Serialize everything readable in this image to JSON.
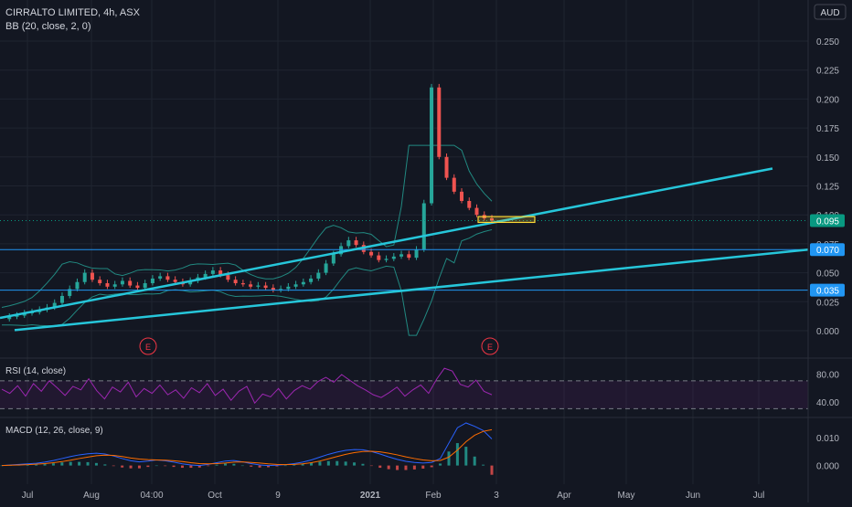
{
  "header": {
    "symbol_line": "CIRRALTO LIMITED, 4h, ASX",
    "indicator_line": "BB (20, close, 2, 0)",
    "currency": "AUD"
  },
  "colors": {
    "background": "#131722",
    "grid": "#1f2430",
    "axis_text": "#b2b5be",
    "trendline": "#26c6da",
    "horizontal_line": "#2196f3",
    "up_candle": "#26a69a",
    "down_candle": "#ef5350",
    "bollinger": "#26a69a",
    "rsi_line": "#9c27b0",
    "macd_line": "#2962ff",
    "signal_line": "#ff6d00",
    "price_badge": "#089981",
    "earnings_marker": "#f23645",
    "highlight_box": "#fdd835"
  },
  "chart_data": [
    {
      "type": "line",
      "name": "price",
      "x_tick_labels": [
        "Jul",
        "Aug",
        "04:00",
        "Oct",
        "9",
        "2021",
        "Feb",
        "3",
        "Apr",
        "May",
        "Jun",
        "Jul"
      ],
      "y_ticks": [
        0.0,
        0.025,
        0.05,
        0.075,
        0.1,
        0.125,
        0.15,
        0.175,
        0.2,
        0.225,
        0.25
      ],
      "y_tick_labels": [
        "0.000",
        "0.025",
        "0.050",
        "0.075",
        "0.100",
        "0.125",
        "0.150",
        "0.175",
        "0.200",
        "0.225",
        "0.250"
      ],
      "ylim": [
        -0.005,
        0.265
      ],
      "grid": true,
      "close_path": [
        0.01,
        0.012,
        0.013,
        0.015,
        0.016,
        0.018,
        0.02,
        0.024,
        0.03,
        0.036,
        0.042,
        0.05,
        0.044,
        0.041,
        0.038,
        0.04,
        0.043,
        0.039,
        0.037,
        0.041,
        0.045,
        0.047,
        0.044,
        0.042,
        0.04,
        0.043,
        0.046,
        0.049,
        0.052,
        0.048,
        0.044,
        0.041,
        0.04,
        0.038,
        0.039,
        0.037,
        0.035,
        0.036,
        0.038,
        0.04,
        0.042,
        0.045,
        0.05,
        0.058,
        0.066,
        0.073,
        0.078,
        0.074,
        0.068,
        0.065,
        0.061,
        0.062,
        0.064,
        0.066,
        0.063,
        0.07,
        0.11,
        0.21,
        0.15,
        0.132,
        0.12,
        0.112,
        0.106,
        0.1,
        0.097,
        0.095
      ],
      "price_labels": [
        {
          "value": 0.095,
          "label": "0.095"
        },
        {
          "value": 0.07,
          "label": "0.070"
        },
        {
          "value": 0.035,
          "label": "0.035"
        }
      ],
      "horizontal_lines": [
        0.07,
        0.035
      ],
      "earnings_markers": [
        "E",
        "E"
      ]
    },
    {
      "type": "line",
      "name": "RSI (14, close)",
      "y_tick_labels": [
        "80.00",
        "40.00"
      ],
      "ylim": [
        20,
        100
      ],
      "bands": [
        70,
        30
      ],
      "values": [
        58,
        52,
        63,
        48,
        66,
        55,
        70,
        60,
        49,
        62,
        57,
        73,
        56,
        44,
        61,
        54,
        68,
        47,
        59,
        52,
        64,
        50,
        57,
        45,
        60,
        53,
        66,
        49,
        58,
        42,
        55,
        62,
        38,
        51,
        47,
        59,
        44,
        56,
        63,
        58,
        69,
        75,
        68,
        79,
        71,
        63,
        57,
        50,
        46,
        53,
        61,
        48,
        57,
        64,
        52,
        72,
        88,
        84,
        65,
        61,
        71,
        55,
        50
      ]
    },
    {
      "type": "line",
      "name": "MACD (12, 26, close, 9)",
      "y_tick_labels": [
        "0.010",
        "0.000"
      ],
      "ylim": [
        -0.006,
        0.0165
      ],
      "macd": [
        0.0,
        0.0002,
        0.0004,
        0.0006,
        0.0008,
        0.0012,
        0.0018,
        0.0025,
        0.0032,
        0.0038,
        0.0042,
        0.0044,
        0.0041,
        0.0034,
        0.0025,
        0.0017,
        0.0013,
        0.0016,
        0.002,
        0.0017,
        0.0012,
        0.0006,
        0.0002,
        0.0,
        0.0004,
        0.001,
        0.0016,
        0.0018,
        0.0013,
        0.0007,
        0.0002,
        0.0,
        0.0001,
        0.0003,
        0.0007,
        0.0012,
        0.002,
        0.003,
        0.004,
        0.0048,
        0.0054,
        0.0057,
        0.0056,
        0.005,
        0.0041,
        0.0031,
        0.0022,
        0.0015,
        0.0011,
        0.0009,
        0.0011,
        0.0025,
        0.008,
        0.0135,
        0.0152,
        0.014,
        0.0125,
        0.0095
      ],
      "signal": [
        0.0,
        0.0001,
        0.0002,
        0.0003,
        0.0005,
        0.0007,
        0.001,
        0.0014,
        0.0019,
        0.0025,
        0.003,
        0.0035,
        0.0037,
        0.0036,
        0.0032,
        0.0027,
        0.0023,
        0.0021,
        0.002,
        0.0019,
        0.0017,
        0.0014,
        0.001,
        0.0007,
        0.0006,
        0.0007,
        0.0009,
        0.0012,
        0.0013,
        0.0011,
        0.0009,
        0.0006,
        0.0004,
        0.0003,
        0.0004,
        0.0006,
        0.001,
        0.0016,
        0.0024,
        0.0032,
        0.004,
        0.0046,
        0.005,
        0.0051,
        0.0049,
        0.0044,
        0.0038,
        0.0031,
        0.0025,
        0.002,
        0.0017,
        0.0018,
        0.003,
        0.0055,
        0.0085,
        0.0108,
        0.0122,
        0.0128
      ]
    }
  ]
}
